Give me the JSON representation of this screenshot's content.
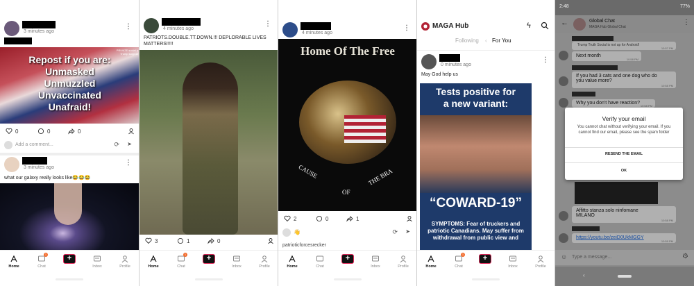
{
  "panel1": {
    "post1": {
      "time": "3 minutes ago",
      "image_text": "Repost if you are: Unmasked Unmuzzled Unvaccinated Unafraid!",
      "line1": "Repost if you are:",
      "line2": "Unmasked",
      "line3": "Unmuzzled",
      "line4": "Unvaccinated",
      "line5": "Unafraid!",
      "corner1": "PRIVATE social p",
      "corner2": "Trump support",
      "likes": "0",
      "comments": "0",
      "reposts": "0",
      "comment_placeholder": "Add a comment..."
    },
    "post2": {
      "time": "3 minutes ago",
      "caption": "what our galaxy really looks like😂😂😂"
    }
  },
  "panel2": {
    "post": {
      "time": "4 minutes ago",
      "caption": "PATRIOTS.DOUBLE.TT.DOWN.!!! DEPLORABLE LIVES MATTERS!!!!!",
      "likes": "3",
      "comments": "1",
      "reposts": "0"
    }
  },
  "panel3": {
    "post": {
      "time": "4 minutes ago",
      "image_top": "Home Of The Free",
      "image_bottom_left": "CAUSE",
      "image_bottom_mid": "OF",
      "image_bottom_right": "THE BRA",
      "likes": "2",
      "comments": "0",
      "reposts": "1",
      "next_user": "patrioticforcesrecker"
    }
  },
  "panel4": {
    "title": "MAGA Hub",
    "tab_following": "Following",
    "tab_foryou": "For You",
    "post": {
      "time": "0 minutes ago",
      "caption": "May God help us",
      "headline1": "Tests positive for",
      "headline2": "a new variant:",
      "big": "“COWARD-19”",
      "symptoms": "SYMPTOMS: Fear of truckers and patriotic Canadians. May suffer from withdrawal from public view and"
    }
  },
  "panel5": {
    "status_time": "2:48",
    "battery": "77%",
    "chat_title": "Global Chat",
    "chat_subtitle": "MAGA Hub Global Chat",
    "messages": [
      {
        "text": "Trump Truth Social is not up for Android!",
        "time": "10:57 PM"
      },
      {
        "text": "Next month",
        "time": "10:58 PM"
      },
      {
        "text": "If you had 3 cats and one dog who do you value more?",
        "time": "10:58 PM"
      },
      {
        "text": "Why you don't have reaction?",
        "time": "10:58 PM"
      },
      {
        "text": "Affitto stanza solo ninfomane MILANO",
        "time": "10:58 PM"
      },
      {
        "text": "https://youtu.be/zeiD0UkMGGY",
        "time": "10:59 PM"
      }
    ],
    "dialog": {
      "title": "Verify your email",
      "message": "You cannot chat without verifying your email. If you cannot find our email, please see the spam folder",
      "resend": "RESEND THE EMAIL",
      "ok": "OK"
    },
    "input_placeholder": "Type a message..."
  },
  "nav": {
    "home": "Home",
    "chat": "Chat",
    "inbox": "Inbox",
    "profile": "Profile",
    "chat_badge": "1"
  },
  "colors": {
    "accent": "#e0285a",
    "badge": "#f36b2b",
    "link": "#1a4fa0"
  }
}
